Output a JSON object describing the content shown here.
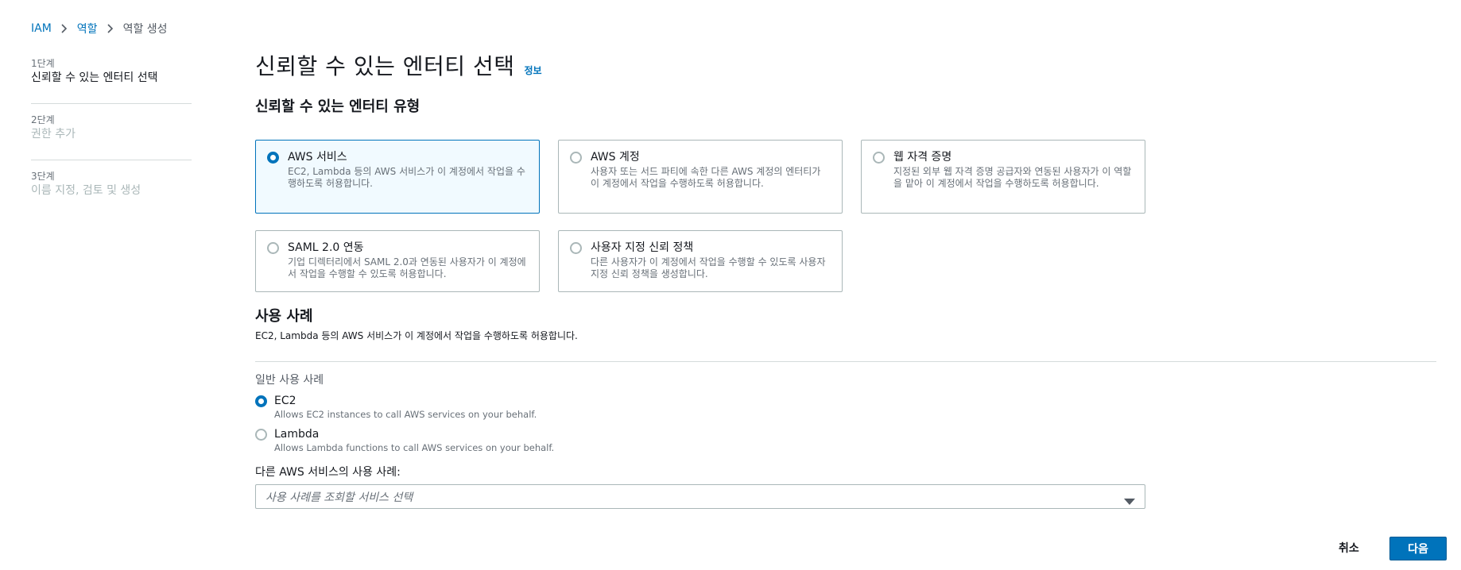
{
  "breadcrumb": {
    "items": [
      "IAM",
      "역할",
      "역할 생성"
    ]
  },
  "steps": [
    {
      "num": "1단계",
      "title": "신뢰할 수 있는 엔터티 선택"
    },
    {
      "num": "2단계",
      "title": "권한 추가"
    },
    {
      "num": "3단계",
      "title": "이름 지정, 검토 및 생성"
    }
  ],
  "header": {
    "title": "신뢰할 수 있는 엔터티 선택",
    "info": "정보"
  },
  "entity_type": {
    "heading": "신뢰할 수 있는 엔터티 유형",
    "selected": "AWS 서비스",
    "options": [
      {
        "title": "AWS 서비스",
        "desc": "EC2, Lambda 등의 AWS 서비스가 이 계정에서 작업을 수행하도록 허용합니다."
      },
      {
        "title": "AWS 계정",
        "desc": "사용자 또는 서드 파티에 속한 다른 AWS 계정의 엔터티가 이 계정에서 작업을 수행하도록 허용합니다."
      },
      {
        "title": "웹 자격 증명",
        "desc": "지정된 외부 웹 자격 증명 공급자와 연동된 사용자가 이 역할을 맡아 이 계정에서 작업을 수행하도록 허용합니다."
      },
      {
        "title": "SAML 2.0 연동",
        "desc": "기업 디렉터리에서 SAML 2.0과 연동된 사용자가 이 계정에서 작업을 수행할 수 있도록 허용합니다."
      },
      {
        "title": "사용자 지정 신뢰 정책",
        "desc": "다른 사용자가 이 계정에서 작업을 수행할 수 있도록 사용자 지정 신뢰 정책을 생성합니다."
      }
    ]
  },
  "use_case": {
    "heading": "사용 사례",
    "desc": "EC2, Lambda 등의 AWS 서비스가 이 계정에서 작업을 수행하도록 허용합니다.",
    "common_label": "일반 사용 사례",
    "selected": "EC2",
    "options": [
      {
        "title": "EC2",
        "desc": "Allows EC2 instances to call AWS services on your behalf."
      },
      {
        "title": "Lambda",
        "desc": "Allows Lambda functions to call AWS services on your behalf."
      }
    ],
    "other_label": "다른 AWS 서비스의 사용 사례:",
    "select_placeholder": "사용 사례를 조회할 서비스 선택"
  },
  "footer": {
    "cancel": "취소",
    "next": "다음"
  },
  "colors": {
    "accent": "#0073bb",
    "selected_bg": "#f1faff"
  }
}
